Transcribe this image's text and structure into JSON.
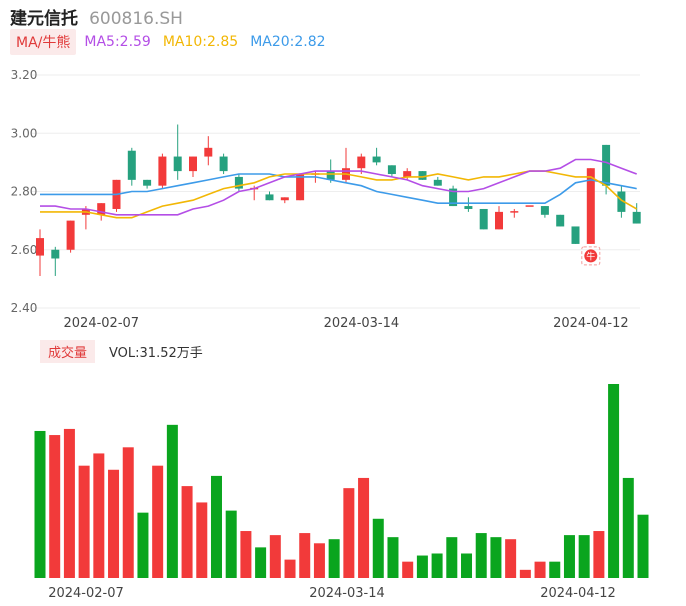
{
  "header": {
    "name": "建元信托",
    "code": "600816.SH"
  },
  "ma_legend": {
    "tag": "MA/牛熊",
    "items": [
      {
        "label": "MA5:2.59",
        "color": "#b44ee6"
      },
      {
        "label": "MA10:2.85",
        "color": "#f2b705"
      },
      {
        "label": "MA20:2.82",
        "color": "#3d9be9"
      }
    ]
  },
  "volume_legend": {
    "tag": "成交量",
    "text": "VOL:31.52万手"
  },
  "colors": {
    "up": "#f23a3a",
    "down": "#0aa51e",
    "candle_down": "#26a17f",
    "ma5": "#b44ee6",
    "ma10": "#f2b705",
    "ma20": "#3d9be9",
    "grid": "#eeeeee"
  },
  "signal_badge": "牛",
  "chart_data": [
    {
      "type": "candlestick",
      "title": "",
      "ylim": [
        2.4,
        3.2
      ],
      "yticks": [
        "3.20",
        "3.00",
        "2.80",
        "2.60",
        "2.40"
      ],
      "x_tick_labels": [
        {
          "index": 1,
          "label": "2024-02-07"
        },
        {
          "index": 18,
          "label": "2024-03-14"
        },
        {
          "index": 33,
          "label": "2024-04-12"
        }
      ],
      "ohlc": [
        [
          2.58,
          2.67,
          2.51,
          2.64
        ],
        [
          2.6,
          2.61,
          2.51,
          2.57
        ],
        [
          2.6,
          2.7,
          2.59,
          2.7
        ],
        [
          2.72,
          2.75,
          2.67,
          2.74
        ],
        [
          2.72,
          2.76,
          2.7,
          2.76
        ],
        [
          2.74,
          2.84,
          2.73,
          2.84
        ],
        [
          2.94,
          2.95,
          2.82,
          2.84
        ],
        [
          2.84,
          2.84,
          2.81,
          2.82
        ],
        [
          2.82,
          2.93,
          2.81,
          2.92
        ],
        [
          2.92,
          3.03,
          2.84,
          2.87
        ],
        [
          2.87,
          2.92,
          2.85,
          2.92
        ],
        [
          2.92,
          2.99,
          2.89,
          2.95
        ],
        [
          2.92,
          2.93,
          2.86,
          2.87
        ],
        [
          2.85,
          2.86,
          2.8,
          2.81
        ],
        [
          2.81,
          2.82,
          2.77,
          2.81
        ],
        [
          2.79,
          2.8,
          2.77,
          2.77
        ],
        [
          2.77,
          2.78,
          2.76,
          2.78
        ],
        [
          2.77,
          2.86,
          2.77,
          2.86
        ],
        [
          2.86,
          2.87,
          2.83,
          2.86
        ],
        [
          2.87,
          2.91,
          2.83,
          2.84
        ],
        [
          2.84,
          2.95,
          2.83,
          2.88
        ],
        [
          2.88,
          2.93,
          2.86,
          2.92
        ],
        [
          2.92,
          2.95,
          2.89,
          2.9
        ],
        [
          2.89,
          2.89,
          2.85,
          2.86
        ],
        [
          2.85,
          2.88,
          2.84,
          2.87
        ],
        [
          2.87,
          2.87,
          2.84,
          2.84
        ],
        [
          2.84,
          2.85,
          2.82,
          2.82
        ],
        [
          2.81,
          2.82,
          2.75,
          2.75
        ],
        [
          2.75,
          2.78,
          2.73,
          2.74
        ],
        [
          2.74,
          2.74,
          2.67,
          2.67
        ],
        [
          2.67,
          2.75,
          2.67,
          2.73
        ],
        [
          2.73,
          2.74,
          2.71,
          2.73
        ],
        [
          2.75,
          2.75,
          2.75,
          2.75
        ],
        [
          2.75,
          2.75,
          2.71,
          2.72
        ],
        [
          2.72,
          2.72,
          2.68,
          2.68
        ],
        [
          2.68,
          2.68,
          2.62,
          2.62
        ],
        [
          2.62,
          2.88,
          2.62,
          2.88
        ],
        [
          2.96,
          2.96,
          2.79,
          2.82
        ],
        [
          2.8,
          2.82,
          2.71,
          2.73
        ],
        [
          2.73,
          2.76,
          2.69,
          2.69
        ]
      ],
      "ma5": [
        2.75,
        2.75,
        2.74,
        2.74,
        2.73,
        2.72,
        2.72,
        2.72,
        2.72,
        2.72,
        2.74,
        2.75,
        2.77,
        2.8,
        2.81,
        2.83,
        2.85,
        2.86,
        2.87,
        2.87,
        2.87,
        2.87,
        2.86,
        2.85,
        2.84,
        2.82,
        2.81,
        2.8,
        2.8,
        2.81,
        2.83,
        2.85,
        2.87,
        2.87,
        2.88,
        2.91,
        2.91,
        2.9,
        2.88,
        2.86
      ],
      "ma10": [
        2.73,
        2.73,
        2.73,
        2.73,
        2.72,
        2.71,
        2.71,
        2.73,
        2.75,
        2.76,
        2.77,
        2.79,
        2.81,
        2.82,
        2.83,
        2.85,
        2.86,
        2.86,
        2.86,
        2.86,
        2.86,
        2.85,
        2.84,
        2.84,
        2.85,
        2.85,
        2.86,
        2.85,
        2.84,
        2.85,
        2.85,
        2.86,
        2.87,
        2.87,
        2.86,
        2.85,
        2.85,
        2.82,
        2.77,
        2.74
      ],
      "ma20": [
        2.79,
        2.79,
        2.79,
        2.79,
        2.79,
        2.79,
        2.8,
        2.8,
        2.81,
        2.82,
        2.83,
        2.84,
        2.85,
        2.86,
        2.86,
        2.86,
        2.85,
        2.85,
        2.85,
        2.84,
        2.83,
        2.82,
        2.8,
        2.79,
        2.78,
        2.77,
        2.76,
        2.76,
        2.76,
        2.76,
        2.76,
        2.76,
        2.76,
        2.76,
        2.79,
        2.83,
        2.84,
        2.83,
        2.82,
        2.81
      ]
    },
    {
      "type": "bar",
      "title": "",
      "ylabel": "VOL",
      "values": [
        72,
        70,
        73,
        55,
        61,
        53,
        64,
        32,
        55,
        75,
        45,
        37,
        50,
        33,
        23,
        15,
        21,
        9,
        22,
        17,
        19,
        44,
        49,
        29,
        20,
        8,
        11,
        12,
        20,
        12,
        22,
        20,
        19,
        4,
        8,
        8,
        21,
        21,
        23,
        95,
        49,
        31
      ],
      "colors": [
        "down",
        "up",
        "up",
        "up",
        "up",
        "up",
        "up",
        "down",
        "up",
        "down",
        "up",
        "up",
        "down",
        "down",
        "up",
        "down",
        "up",
        "up",
        "up",
        "up",
        "down",
        "up",
        "up",
        "down",
        "down",
        "up",
        "down",
        "down",
        "down",
        "down",
        "down",
        "down",
        "up",
        "up",
        "up",
        "down",
        "down",
        "down",
        "up",
        "down",
        "down",
        "down"
      ]
    }
  ]
}
